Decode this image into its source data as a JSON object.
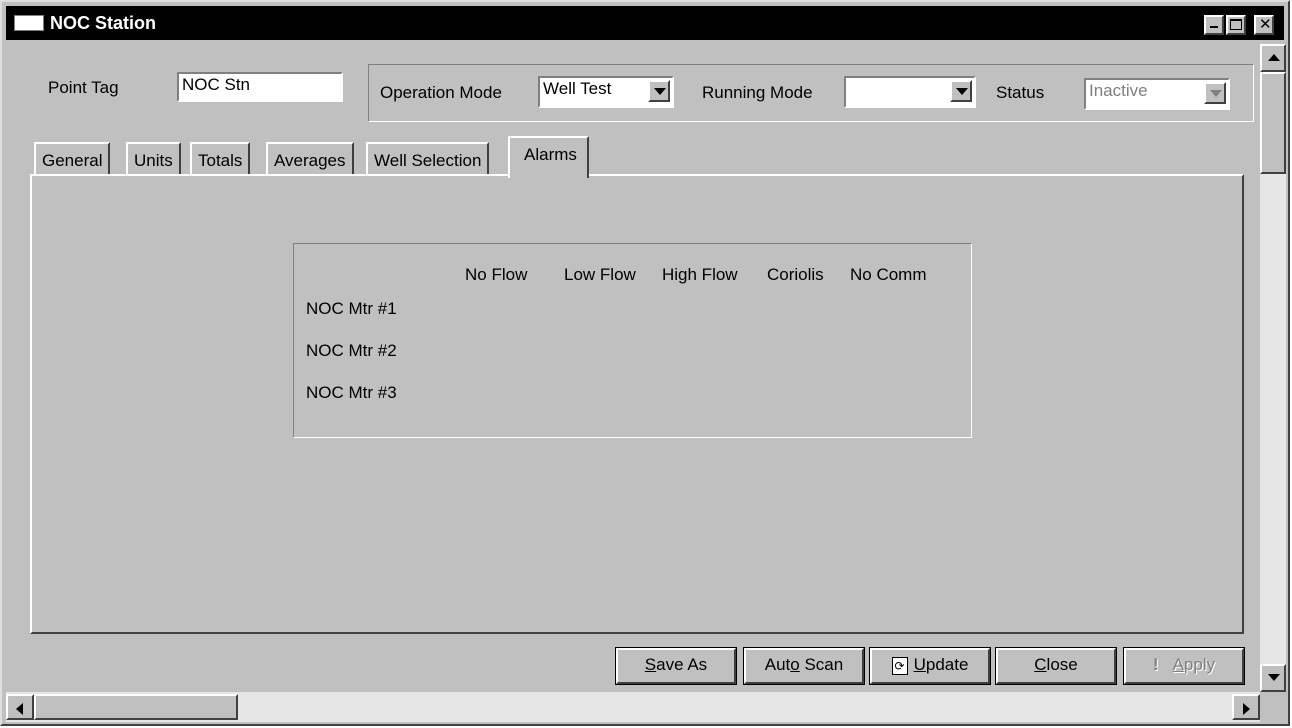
{
  "window": {
    "title": "NOC Station"
  },
  "header": {
    "point_tag_label": "Point Tag",
    "point_tag_value": "NOC Stn",
    "operation_mode_label": "Operation Mode",
    "operation_mode_value": "Well Test",
    "running_mode_label": "Running Mode",
    "running_mode_value": "",
    "status_label": "Status",
    "status_value": "Inactive"
  },
  "tabs": [
    {
      "label": "General"
    },
    {
      "label": "Units"
    },
    {
      "label": "Totals"
    },
    {
      "label": "Averages"
    },
    {
      "label": "Well Selection"
    },
    {
      "label": "Alarms",
      "active": true
    }
  ],
  "alarms": {
    "columns": [
      "No Flow",
      "Low Flow",
      "High Flow",
      "Coriolis",
      "No Comm"
    ],
    "rows": [
      "NOC Mtr #1",
      "NOC Mtr #2",
      "NOC Mtr #3"
    ]
  },
  "buttons": {
    "save_as": {
      "pre": "",
      "u": "S",
      "post": "ave As"
    },
    "auto_scan": {
      "pre": "Aut",
      "u": "o",
      "post": " Scan"
    },
    "update": {
      "pre": "",
      "u": "U",
      "post": "pdate"
    },
    "close": {
      "pre": "",
      "u": "C",
      "post": "lose"
    },
    "apply": {
      "pre": "",
      "u": "A",
      "post": "pply"
    }
  }
}
